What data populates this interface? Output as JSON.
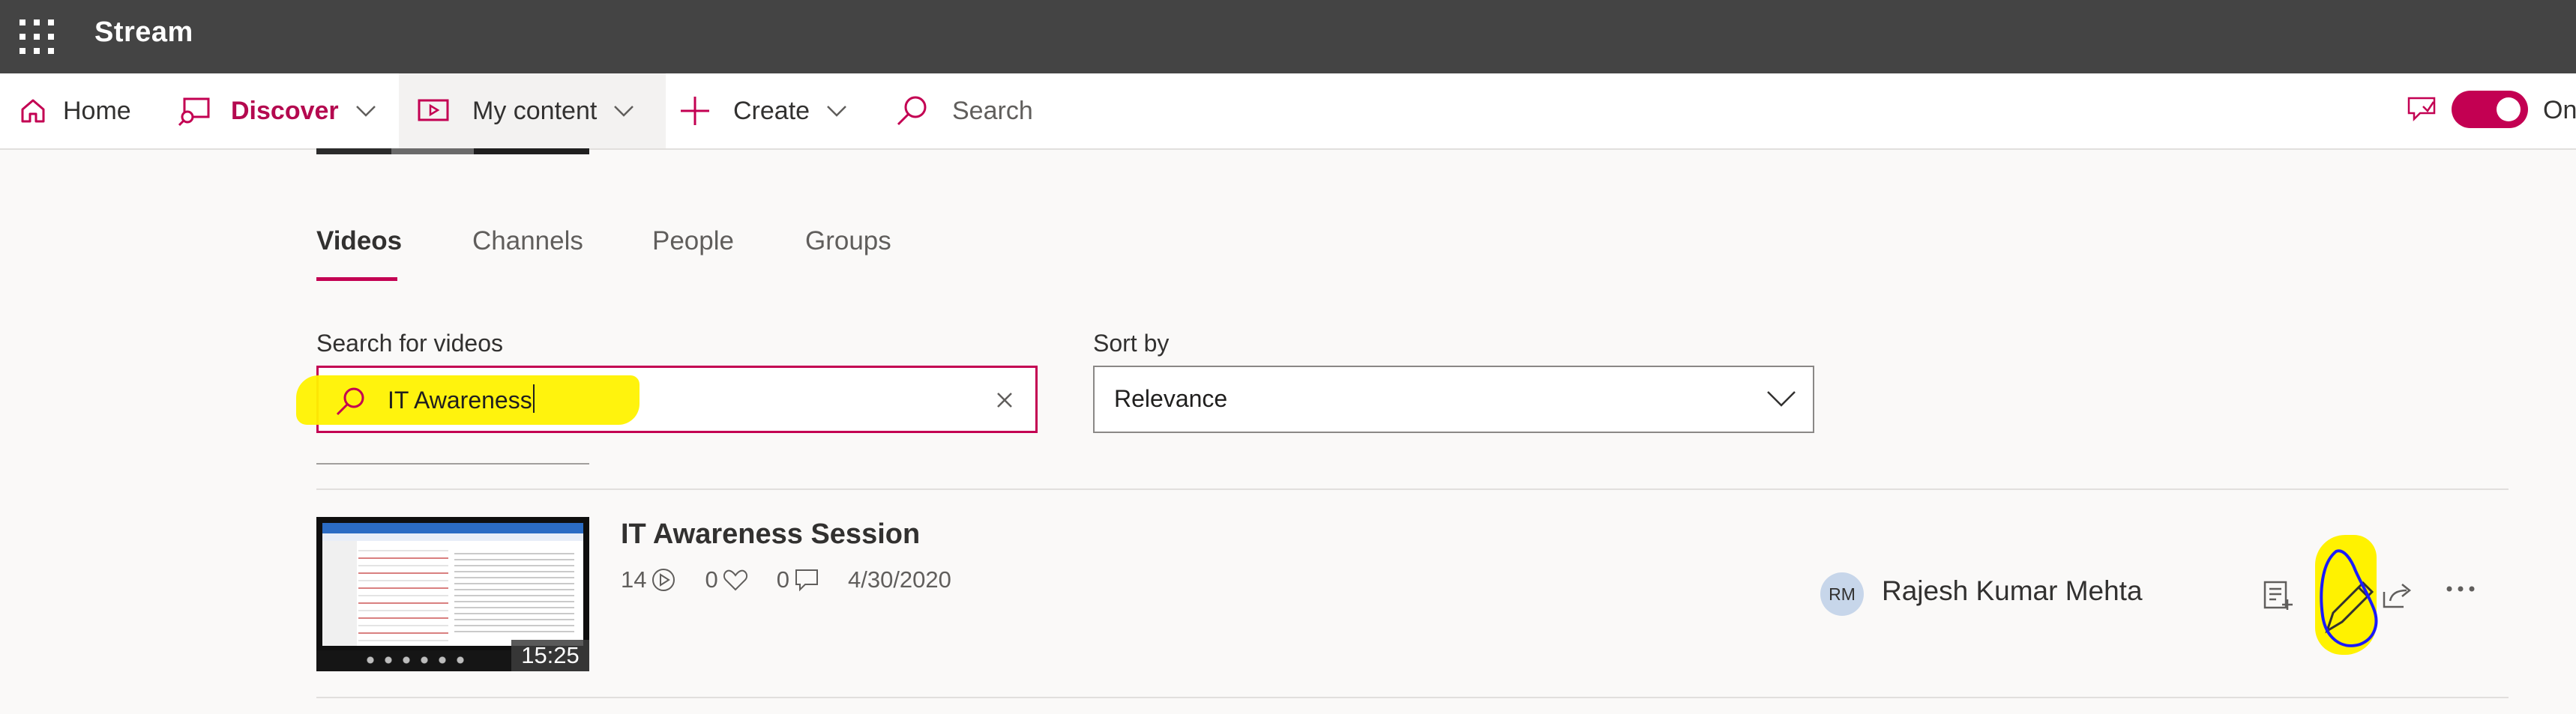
{
  "app": {
    "title": "Stream"
  },
  "nav": {
    "home": "Home",
    "discover": "Discover",
    "my_content": "My content",
    "create": "Create",
    "search": "Search",
    "toggle_label": "On"
  },
  "tabs": [
    "Videos",
    "Channels",
    "People",
    "Groups"
  ],
  "search": {
    "label": "Search for videos",
    "value": "IT Awareness"
  },
  "sort": {
    "label": "Sort by",
    "value": "Relevance"
  },
  "result": {
    "title": "IT Awareness Session",
    "duration": "15:25",
    "views": "14",
    "likes": "0",
    "comments": "0",
    "date": "4/30/2020",
    "owner_initials": "RM",
    "owner": "Rajesh Kumar Mehta"
  },
  "colors": {
    "accent": "#c30052",
    "appbar": "#444444",
    "highlight": "#fff200",
    "annotation": "#1a1aff"
  },
  "icons": [
    "waffle-icon",
    "home-icon",
    "discover-icon",
    "video-icon",
    "plus-icon",
    "search-icon",
    "feedback-icon",
    "clear-icon",
    "chevron-down-icon",
    "play-icon",
    "heart-icon",
    "comment-icon",
    "add-to-playlist-icon",
    "edit-icon",
    "share-icon",
    "more-icon"
  ]
}
